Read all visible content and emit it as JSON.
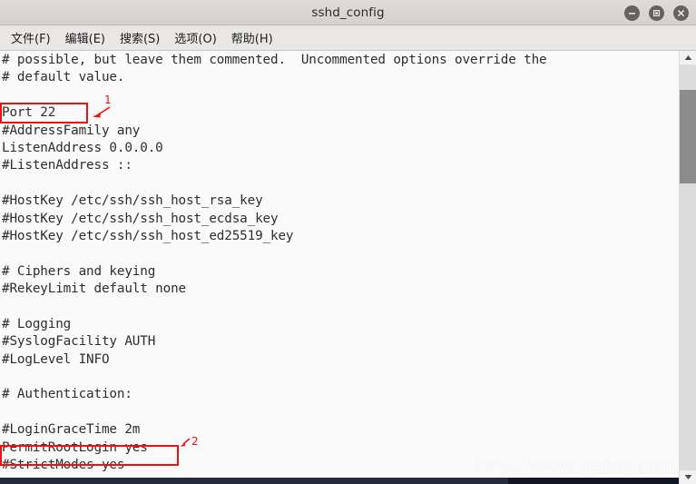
{
  "window": {
    "title": "sshd_config",
    "controls": [
      {
        "name": "minimize",
        "glyph": "minus"
      },
      {
        "name": "maximize",
        "glyph": "square"
      },
      {
        "name": "close",
        "glyph": "cross"
      }
    ]
  },
  "menubar": {
    "items": [
      {
        "label": "文件(F)",
        "name": "menu-file"
      },
      {
        "label": "编辑(E)",
        "name": "menu-edit"
      },
      {
        "label": "搜索(S)",
        "name": "menu-search"
      },
      {
        "label": "选项(O)",
        "name": "menu-options"
      },
      {
        "label": "帮助(H)",
        "name": "menu-help"
      }
    ]
  },
  "editor": {
    "lines": [
      "# possible, but leave them commented.  Uncommented options override the",
      "# default value.",
      "",
      "Port 22",
      "#AddressFamily any",
      "ListenAddress 0.0.0.0",
      "#ListenAddress ::",
      "",
      "#HostKey /etc/ssh/ssh_host_rsa_key",
      "#HostKey /etc/ssh/ssh_host_ecdsa_key",
      "#HostKey /etc/ssh/ssh_host_ed25519_key",
      "",
      "# Ciphers and keying",
      "#RekeyLimit default none",
      "",
      "# Logging",
      "#SyslogFacility AUTH",
      "#LogLevel INFO",
      "",
      "# Authentication:",
      "",
      "#LoginGraceTime 2m",
      "PermitRootLogin yes",
      "#StrictModes yes"
    ]
  },
  "annotations": [
    {
      "number": "1",
      "target_text": "Port 22"
    },
    {
      "number": "2",
      "target_text": "PermitRootLogin yes"
    }
  ],
  "watermark": {
    "text": "http://www.mzbky.com"
  },
  "colors": {
    "annotation_red": "#ee1111",
    "titlebar": "#d8d5d2",
    "editor_background": "#fafafa",
    "text": "#2e2e2e",
    "scrollbar_thumb": "#8c8c8c"
  }
}
